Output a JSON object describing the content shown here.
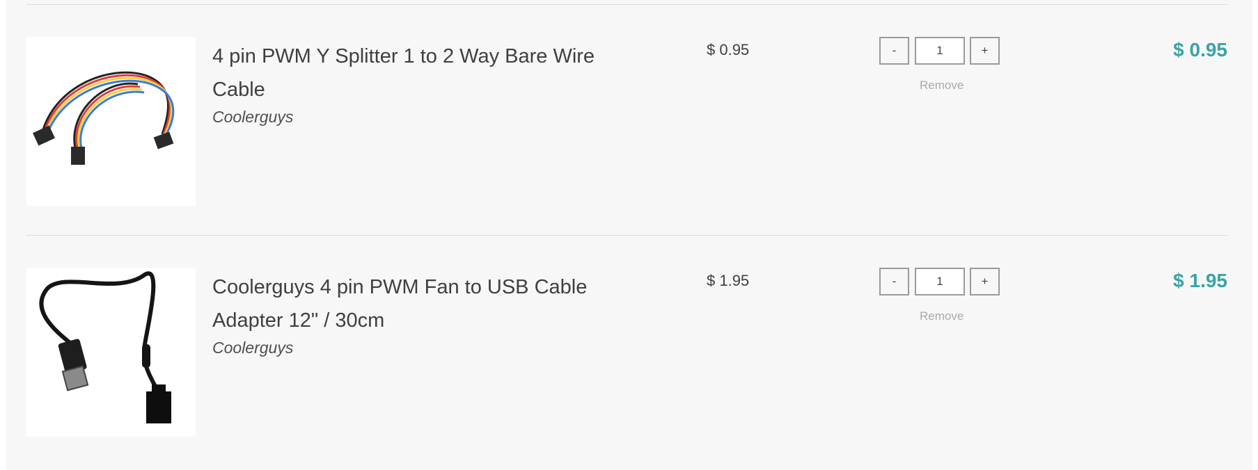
{
  "colors": {
    "accent_total": "#3aa3a5",
    "background": "#f7f7f7",
    "text": "#3f3f3f",
    "muted": "#a9a9a9"
  },
  "cart": {
    "items": [
      {
        "title": "4 pin PWM Y Splitter 1 to 2 Way Bare Wire Cable",
        "vendor": "Coolerguys",
        "unit_price": "$ 0.95",
        "quantity": "1",
        "minus_label": "-",
        "plus_label": "+",
        "remove_label": "Remove",
        "line_total": "$ 0.95",
        "image_icon": "y-splitter-cable-photo"
      },
      {
        "title": "Coolerguys 4 pin PWM Fan to USB Cable Adapter 12\" / 30cm",
        "vendor": "Coolerguys",
        "unit_price": "$ 1.95",
        "quantity": "1",
        "minus_label": "-",
        "plus_label": "+",
        "remove_label": "Remove",
        "line_total": "$ 1.95",
        "image_icon": "usb-fan-cable-photo"
      }
    ]
  }
}
